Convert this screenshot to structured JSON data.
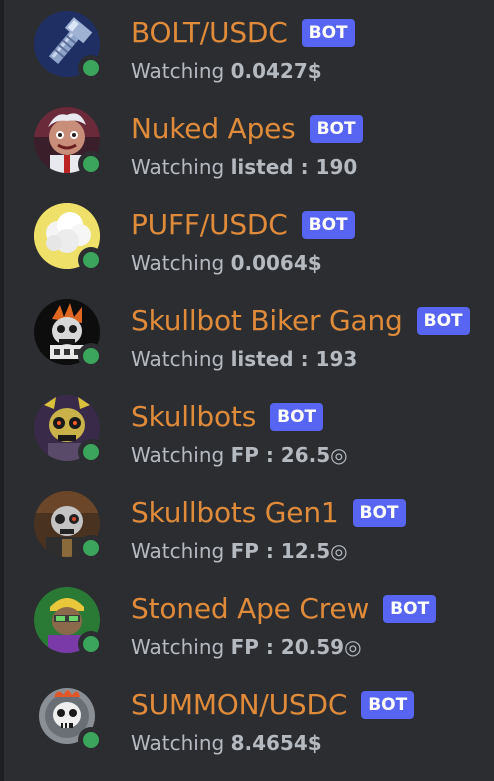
{
  "members": [
    {
      "name": "BOLT/USDC",
      "badge": "BOT",
      "activity_prefix": "Watching",
      "activity_value": "0.0427$",
      "avatar": "bolt-icon",
      "status_color": "#3ba55d"
    },
    {
      "name": "Nuked Apes",
      "badge": "BOT",
      "activity_prefix": "Watching",
      "activity_value": "listed : 190",
      "avatar": "nuked-ape-avatar",
      "status_color": "#3ba55d"
    },
    {
      "name": "PUFF/USDC",
      "badge": "BOT",
      "activity_prefix": "Watching",
      "activity_value": "0.0064$",
      "avatar": "puff-cloud-avatar",
      "status_color": "#3ba55d"
    },
    {
      "name": "Skullbot Biker Gang",
      "badge": "BOT",
      "activity_prefix": "Watching",
      "activity_value": "listed : 193",
      "avatar": "skullbot-biker-avatar",
      "status_color": "#3ba55d"
    },
    {
      "name": "Skullbots",
      "badge": "BOT",
      "activity_prefix": "Watching",
      "activity_value": "FP : 26.5◎",
      "avatar": "skullbots-avatar",
      "status_color": "#3ba55d"
    },
    {
      "name": "Skullbots Gen1",
      "badge": "BOT",
      "activity_prefix": "Watching",
      "activity_value": "FP : 12.5◎",
      "avatar": "skullbots-gen1-avatar",
      "status_color": "#3ba55d"
    },
    {
      "name": "Stoned Ape Crew",
      "badge": "BOT",
      "activity_prefix": "Watching",
      "activity_value": "FP : 20.59◎",
      "avatar": "stoned-ape-avatar",
      "status_color": "#3ba55d"
    },
    {
      "name": "SUMMON/USDC",
      "badge": "BOT",
      "activity_prefix": "Watching",
      "activity_value": "8.4654$",
      "avatar": "summon-skull-avatar",
      "status_color": "#3ba55d"
    }
  ],
  "colors": {
    "background": "#2b2d31",
    "name": "#e08b3a",
    "badge": "#5865f2",
    "activity": "#b5bac1",
    "online": "#3ba55d"
  }
}
